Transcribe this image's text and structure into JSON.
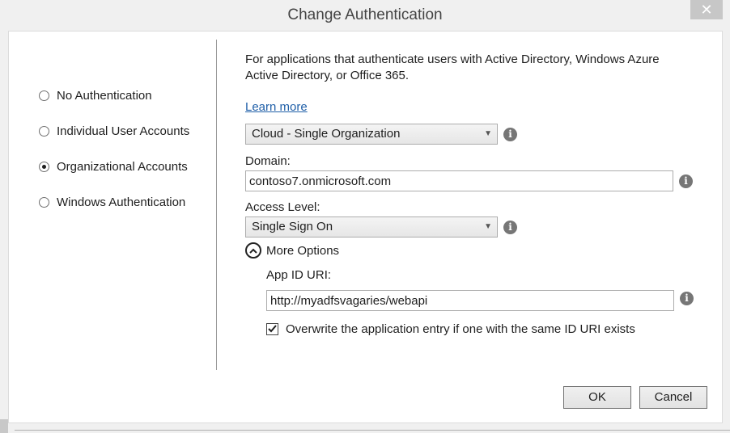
{
  "window": {
    "title": "Change Authentication",
    "close_glyph": "✕"
  },
  "auth_options": [
    {
      "label": "No Authentication",
      "selected": false
    },
    {
      "label": "Individual User Accounts",
      "selected": false
    },
    {
      "label": "Organizational Accounts",
      "selected": true
    },
    {
      "label": "Windows Authentication",
      "selected": false
    }
  ],
  "description": "For applications that authenticate users with Active Directory, Windows Azure Active Directory, or Office 365.",
  "learn_more": "Learn more",
  "org_type": {
    "selected": "Cloud - Single Organization"
  },
  "domain": {
    "label": "Domain:",
    "value": "contoso7.onmicrosoft.com"
  },
  "access_level": {
    "label": "Access Level:",
    "selected": "Single Sign On"
  },
  "more_options": {
    "label": "More Options",
    "expanded": true
  },
  "app_id_uri": {
    "label": "App ID URI:",
    "value": "http://myadfsvagaries/webapi"
  },
  "overwrite": {
    "label": "Overwrite the application entry if one with the same ID URI exists",
    "checked": true
  },
  "buttons": {
    "ok": "OK",
    "cancel": "Cancel"
  },
  "icons": {
    "info": "i",
    "dropdown_arrow": "▼"
  },
  "colors": {
    "link": "#1f5fa8",
    "info_icon": "#767676",
    "close_button": "#c7c7c7"
  }
}
